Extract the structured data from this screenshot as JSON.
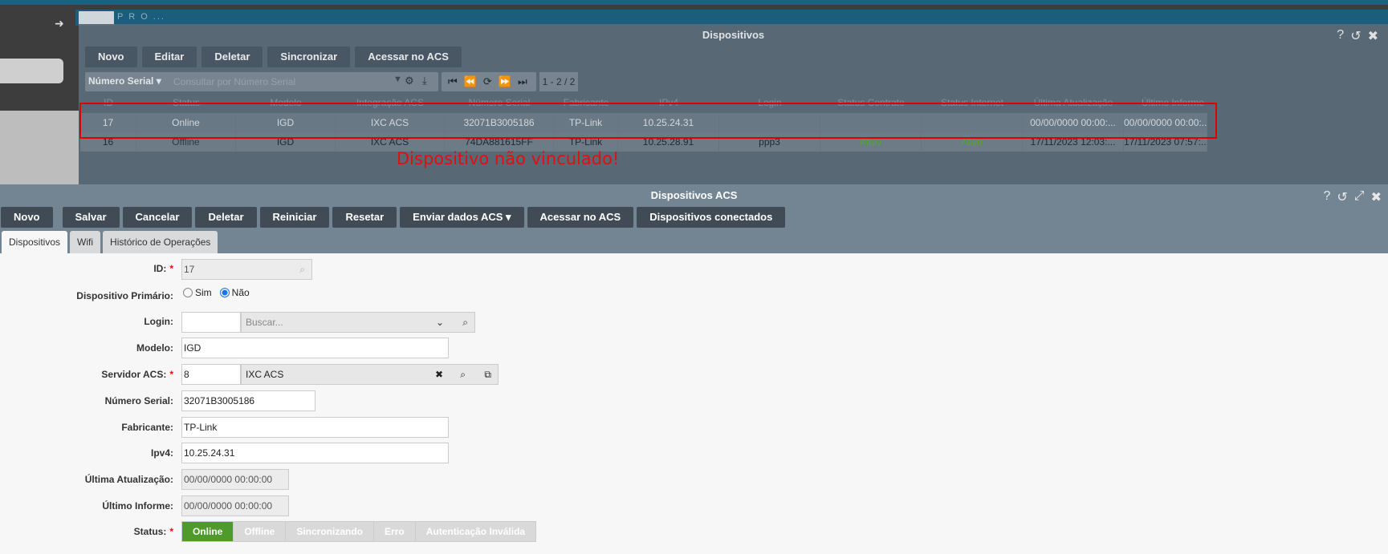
{
  "background": {
    "app_label": "P R O ..."
  },
  "devices_window": {
    "title": "Dispositivos",
    "toolbar": [
      "Novo",
      "Editar",
      "Deletar",
      "Sincronizar",
      "Acessar no ACS"
    ],
    "filter_field": "Número Serial",
    "filter_placeholder": "Consultar por Número Serial",
    "page_count": "1 - 2 / 2",
    "columns": [
      "ID",
      "Status",
      "Modelo",
      "Integração ACS",
      "Número Serial",
      "Fabricante",
      "IPv4",
      "Login",
      "Status Contrato",
      "Status Internet",
      "Última Atualização",
      "Último Informe"
    ],
    "rows": [
      [
        "17",
        "Online",
        "IGD",
        "IXC ACS",
        "32071B3005186",
        "TP-Link",
        "10.25.24.31",
        "",
        "",
        "",
        "00/00/0000 00:00:...",
        "00/00/0000 00:00:..."
      ],
      [
        "16",
        "Offline",
        "IGD",
        "IXC ACS",
        "74DA881615FF",
        "TP-Link",
        "10.25.28.91",
        "ppp3",
        "Ativo",
        "Ativo",
        "17/11/2023 12:03:...",
        "17/11/2023 07:57:..."
      ]
    ]
  },
  "annotation": "Dispositivo não vinculado!",
  "acs_window": {
    "title": "Dispositivos ACS",
    "toolbar": [
      "Novo",
      "Salvar",
      "Cancelar",
      "Deletar",
      "Reiniciar",
      "Resetar",
      "Enviar dados ACS",
      "Acessar no ACS",
      "Dispositivos conectados"
    ],
    "tabs": [
      "Dispositivos",
      "Wifi",
      "Histórico de Operações"
    ],
    "form": {
      "id_label": "ID:",
      "id_value": "17",
      "primary_label": "Dispositivo Primário:",
      "primary_yes": "Sim",
      "primary_no": "Não",
      "login_label": "Login:",
      "login_placeholder": "Buscar...",
      "model_label": "Modelo:",
      "model_value": "IGD",
      "acs_label": "Servidor ACS:",
      "acs_id": "8",
      "acs_name": "IXC ACS",
      "serial_label": "Número Serial:",
      "serial_value": "32071B3005186",
      "maker_label": "Fabricante:",
      "maker_value": "TP-Link",
      "ipv4_label": "Ipv4:",
      "ipv4_value": "10.25.24.31",
      "updated_label": "Última Atualização:",
      "updated_value": "00/00/0000 00:00:00",
      "informed_label": "Último Informe:",
      "informed_value": "00/00/0000 00:00:00",
      "status_label": "Status:",
      "status_options": [
        "Online",
        "Offline",
        "Sincronizando",
        "Erro",
        "Autenticação Inválida"
      ]
    }
  }
}
